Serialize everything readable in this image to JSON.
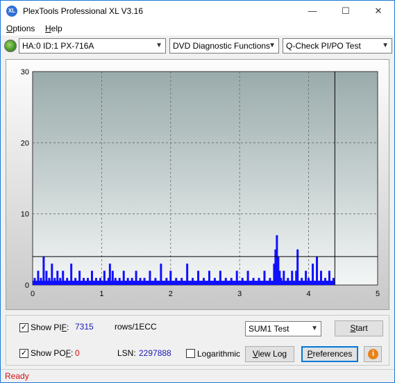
{
  "app": {
    "title": "PlexTools Professional XL V3.16",
    "icon_text": "XL"
  },
  "window_controls": {
    "minimize": "—",
    "maximize": "☐",
    "close": "✕"
  },
  "menu": {
    "items": [
      {
        "label": "Options",
        "underline": "O"
      },
      {
        "label": "Help",
        "underline": "H"
      }
    ]
  },
  "toolbar": {
    "drive_icon": "disc-drive-icon",
    "drive": "HA:0 ID:1  PX-716A",
    "function": "DVD Diagnostic Functions",
    "test": "Q-Check PI/PO Test"
  },
  "chart_data": {
    "type": "bar",
    "xlim": [
      0,
      5
    ],
    "ylim": [
      0,
      30
    ],
    "x_ticks": [
      "0",
      "1",
      "2",
      "3",
      "4",
      "5"
    ],
    "y_ticks": [
      "0",
      "10",
      "20",
      "30"
    ],
    "grid": true,
    "threshold_line": 4,
    "end_marker_x": 4.38,
    "series": [
      {
        "color": "#1010ff",
        "x": [
          0.03,
          0.08,
          0.12,
          0.16,
          0.2,
          0.24,
          0.28,
          0.32,
          0.36,
          0.4,
          0.44,
          0.5,
          0.56,
          0.62,
          0.68,
          0.74,
          0.8,
          0.86,
          0.92,
          0.98,
          1.04,
          1.1,
          1.12,
          1.16,
          1.2,
          1.26,
          1.32,
          1.38,
          1.44,
          1.5,
          1.56,
          1.62,
          1.7,
          1.78,
          1.86,
          1.94,
          2.0,
          2.08,
          2.16,
          2.24,
          2.32,
          2.4,
          2.48,
          2.56,
          2.64,
          2.72,
          2.8,
          2.88,
          2.96,
          3.04,
          3.12,
          3.2,
          3.28,
          3.36,
          3.44,
          3.5,
          3.52,
          3.54,
          3.56,
          3.58,
          3.6,
          3.64,
          3.7,
          3.76,
          3.82,
          3.84,
          3.9,
          3.96,
          4.0,
          4.06,
          4.12,
          4.18,
          4.24,
          4.3,
          4.36
        ],
        "values": [
          1,
          2,
          1,
          4,
          2,
          1,
          3,
          1,
          2,
          1,
          2,
          1,
          3,
          1,
          2,
          1,
          1,
          2,
          1,
          1,
          2,
          1,
          3,
          2,
          1,
          1,
          2,
          1,
          1,
          2,
          1,
          1,
          2,
          1,
          3,
          1,
          2,
          1,
          1,
          3,
          1,
          2,
          1,
          2,
          1,
          2,
          1,
          1,
          2,
          1,
          2,
          1,
          1,
          2,
          1,
          3,
          5,
          7,
          4,
          2,
          1,
          2,
          1,
          2,
          2,
          5,
          1,
          2,
          1,
          3,
          4,
          2,
          1,
          2,
          1
        ]
      }
    ]
  },
  "controls": {
    "show_pif": {
      "label": "Show PIF:",
      "checked": true,
      "value": "7315",
      "unit": "rows/1ECC"
    },
    "show_pof": {
      "label": "Show POF:",
      "checked": true,
      "value": "0"
    },
    "lsn": {
      "label": "LSN:",
      "value": "2297888"
    },
    "logarithmic": {
      "label": "Logarithmic",
      "checked": false
    },
    "test_select": "SUM1 Test",
    "start_button": "Start",
    "view_log_button": "View Log",
    "preferences_button": "Preferences",
    "info_icon": "info-icon"
  },
  "status": {
    "text": "Ready"
  }
}
